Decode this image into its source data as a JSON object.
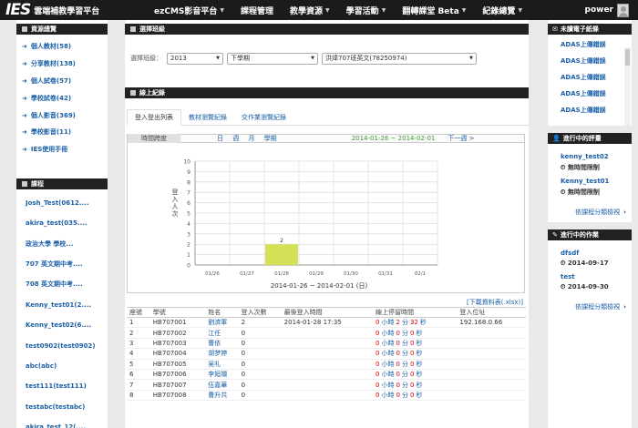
{
  "navbar": {
    "logo_mark": "IES",
    "logo_text": "雲端補教學習平台",
    "items": [
      {
        "label": "ezCMS影音平台",
        "caret": true
      },
      {
        "label": "課程管理",
        "caret": false
      },
      {
        "label": "教學資源",
        "caret": true
      },
      {
        "label": "學習活動",
        "caret": true
      },
      {
        "label": "翻轉課堂 Beta",
        "caret": true
      },
      {
        "label": "紀錄總覽",
        "caret": true
      }
    ],
    "user": "power"
  },
  "left": {
    "resources_title": "資源總覽",
    "resources": [
      "個人教材(58)",
      "分享教材(138)",
      "個人試卷(57)",
      "學校試卷(42)",
      "個人影音(369)",
      "學校影音(11)",
      "IES使用手冊"
    ],
    "courses_title": "課程",
    "courses": [
      "Josh_Test(0612....",
      "akira_test(035....",
      "政治大學 學校...",
      "707 英文期中考....",
      "708 英文期中考....",
      "Kenny_test01(2....",
      "Kenny_test02(6....",
      "test0902(test0902)",
      "abc(abc)",
      "test111(test111)",
      "testabc(testabc)",
      "akira_test_12(...."
    ]
  },
  "main": {
    "select_class_title": "選擇班級",
    "class_label": "選擇班級：",
    "year": "2013",
    "term": "下學期",
    "class_name": "洪煒707班英文(78250974)",
    "online_title": "線上紀錄",
    "tabs": [
      "登入登出列表",
      "教材瀏覽紀錄",
      "交作業瀏覽紀錄"
    ],
    "period_label": "時間跨度",
    "period_modes": "日 週 月 學期",
    "period_range": "2014-01-26 ~ 2014-02-01",
    "next_label": "下一週 >",
    "download_label": "[下載資料表(.xlsx)]",
    "table_headers": [
      "座號",
      "學號",
      "姓名",
      "登入次數",
      "最後登入時間",
      "線上停留時間",
      "登入位址"
    ],
    "rows": [
      {
        "seat": "1",
        "id": "HB707001",
        "name": "劉濟軍",
        "count": "2",
        "last": "2014-01-28 17:35",
        "h": "0",
        "m": "2",
        "s": "32",
        "ip": "192.168.0.66"
      },
      {
        "seat": "2",
        "id": "HB707002",
        "name": "江任",
        "count": "0",
        "last": "",
        "h": "0",
        "m": "0",
        "s": "0",
        "ip": ""
      },
      {
        "seat": "3",
        "id": "HB707003",
        "name": "曹依",
        "count": "0",
        "last": "",
        "h": "0",
        "m": "0",
        "s": "0",
        "ip": ""
      },
      {
        "seat": "4",
        "id": "HB707004",
        "name": "胡梦婷",
        "count": "0",
        "last": "",
        "h": "0",
        "m": "0",
        "s": "0",
        "ip": ""
      },
      {
        "seat": "5",
        "id": "HB707005",
        "name": "吴礼",
        "count": "0",
        "last": "",
        "h": "0",
        "m": "0",
        "s": "0",
        "ip": ""
      },
      {
        "seat": "6",
        "id": "HB707006",
        "name": "李姮嬛",
        "count": "0",
        "last": "",
        "h": "0",
        "m": "0",
        "s": "0",
        "ip": ""
      },
      {
        "seat": "7",
        "id": "HB707007",
        "name": "伍嘉華",
        "count": "0",
        "last": "",
        "h": "0",
        "m": "0",
        "s": "0",
        "ip": ""
      },
      {
        "seat": "8",
        "id": "HB707008",
        "name": "曹升共",
        "count": "0",
        "last": "",
        "h": "0",
        "m": "0",
        "s": "0",
        "ip": ""
      }
    ],
    "time_units": {
      "h": "小時",
      "m": "分",
      "s": "秒"
    }
  },
  "right": {
    "ads_title": "未讀電子紙條",
    "ads": [
      "ADAS上傳錯誤",
      "ADAS上傳錯誤",
      "ADAS上傳錯誤",
      "ADAS上傳錯誤",
      "ADAS上傳錯誤"
    ],
    "eval_title": "進行中的評量",
    "evals": [
      {
        "name": "kenny_test02",
        "sub": "無時間限制"
      },
      {
        "name": "Kenny_test01",
        "sub": "無時間限制"
      }
    ],
    "eval_more": "依課程分類檢視",
    "hw_title": "進行中的作業",
    "homeworks": [
      {
        "name": "dfsdf",
        "date": "2014-09-17"
      },
      {
        "name": "test",
        "date": "2014-09-30"
      }
    ],
    "hw_more": "依課程分類檢視"
  },
  "chart_data": {
    "type": "bar",
    "categories": [
      "01/26",
      "01/27",
      "01/28",
      "01/29",
      "01/30",
      "01/31",
      "02/1"
    ],
    "values": [
      0,
      0,
      2,
      0,
      0,
      0,
      0
    ],
    "data_labels": [
      "",
      "",
      "2",
      "",
      "",
      "",
      ""
    ],
    "ylabel": "登入人次",
    "xlabel": "2014-01-26 ~ 2014-02-01 (日)",
    "ylim": [
      0,
      10
    ],
    "yticks": [
      0,
      1,
      2,
      3,
      4,
      5,
      6,
      7,
      8,
      9,
      10
    ],
    "bar_color": "#d4e157",
    "grid": true
  }
}
